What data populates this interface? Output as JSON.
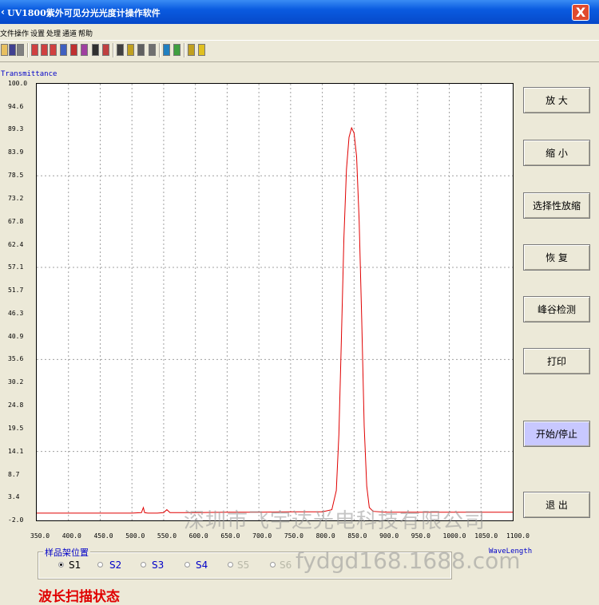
{
  "window": {
    "title": "UV1800紫外可见分光光度计操作软件",
    "close_label": "X"
  },
  "menu": [
    "文件",
    "操作",
    "设置",
    "处理",
    "通道",
    "帮助"
  ],
  "toolbar": {
    "icons": [
      "open-icon",
      "save-icon",
      "print-icon",
      "scan-icon",
      "scan-multi-icon",
      "wave-icon",
      "zoom-icon",
      "peak-icon",
      "measure-icon",
      "tools-icon",
      "baseline-icon",
      "undo-icon",
      "cursor-icon",
      "grid-icon",
      "export-icon",
      "settings-icon",
      "color-icon",
      "text-icon",
      "warning-icon"
    ]
  },
  "plot": {
    "ylabel": "Transmittance",
    "xlabel": "WaveLength"
  },
  "buttons": [
    "放 大",
    "缩 小",
    "选择性放缩",
    "恢 复",
    "峰谷检测",
    "打印",
    "开始/停止",
    "退 出"
  ],
  "sample_holder": {
    "label": "样品架位置",
    "options": [
      "S1",
      "S2",
      "S3",
      "S4",
      "S5",
      "S6"
    ],
    "selected": "S1"
  },
  "status": "波长扫描状态",
  "watermark": {
    "company": "深圳市飞宇达光电科技有限公司",
    "site": "fydgd168.1688.com"
  },
  "chart_data": {
    "type": "line",
    "title": "",
    "xlabel": "WaveLength",
    "ylabel": "Transmittance",
    "xlim": [
      350.0,
      1100.0
    ],
    "ylim": [
      -2.0,
      100.0
    ],
    "x_ticks": [
      "350.0",
      "400.0",
      "450.0",
      "500.0",
      "550.0",
      "600.0",
      "650.0",
      "700.0",
      "750.0",
      "800.0",
      "850.0",
      "900.0",
      "950.0",
      "1000.0",
      "1050.0",
      "1100.0"
    ],
    "y_ticks": [
      "100.0",
      "94.6",
      "89.3",
      "83.9",
      "78.5",
      "73.2",
      "67.8",
      "62.4",
      "57.1",
      "51.7",
      "46.3",
      "40.9",
      "35.6",
      "30.2",
      "24.8",
      "19.5",
      "14.1",
      "8.7",
      "3.4",
      "-2.0"
    ],
    "grid": true,
    "series": [
      {
        "color": "#e00000",
        "x": [
          350,
          400,
          450,
          500,
          515,
          518,
          520,
          525,
          540,
          550,
          555,
          560,
          600,
          650,
          700,
          750,
          800,
          815,
          822,
          826,
          830,
          834,
          838,
          842,
          846,
          850,
          854,
          858,
          862,
          866,
          870,
          874,
          880,
          900,
          950,
          1000,
          1050,
          1100
        ],
        "y": [
          -0.3,
          -0.3,
          -0.3,
          -0.3,
          -0.2,
          1.0,
          -0.2,
          -0.3,
          -0.3,
          -0.2,
          0.5,
          -0.2,
          -0.2,
          -0.1,
          -0.1,
          0.0,
          0.0,
          0.5,
          5.0,
          18.0,
          40.0,
          64.0,
          80.0,
          87.5,
          89.7,
          88.5,
          83.0,
          68.0,
          45.0,
          20.0,
          6.0,
          1.0,
          0.1,
          -0.1,
          -0.1,
          -0.1,
          -0.1,
          -0.1
        ]
      }
    ]
  }
}
